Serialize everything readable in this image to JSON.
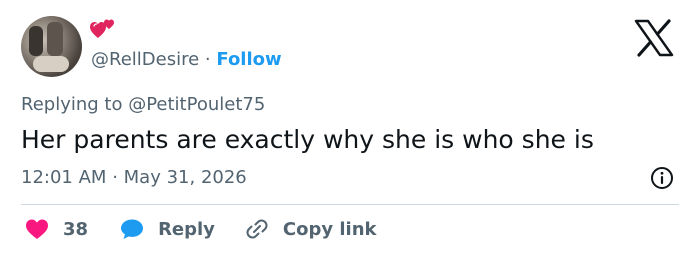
{
  "author": {
    "handle": "@RellDesire",
    "separator": "·",
    "follow_label": "Follow"
  },
  "brand": {
    "logo": "x-logo"
  },
  "tweet": {
    "replying_to": "Replying to @PetitPoulet75",
    "text": "Her parents are exactly why she is who she is",
    "time": "12:01 AM",
    "date_separator": "·",
    "date": "May 31, 2026"
  },
  "actions": {
    "like_count": "38",
    "reply_label": "Reply",
    "copy_link_label": "Copy link"
  },
  "colors": {
    "like": "#f91880",
    "reply": "#1d9bf0",
    "follow": "#1d9bf0",
    "muted": "#536471",
    "text": "#0f1419"
  },
  "icons": [
    "two-hearts-icon",
    "x-logo-icon",
    "info-icon",
    "heart-icon",
    "reply-bubble-icon",
    "link-icon"
  ]
}
